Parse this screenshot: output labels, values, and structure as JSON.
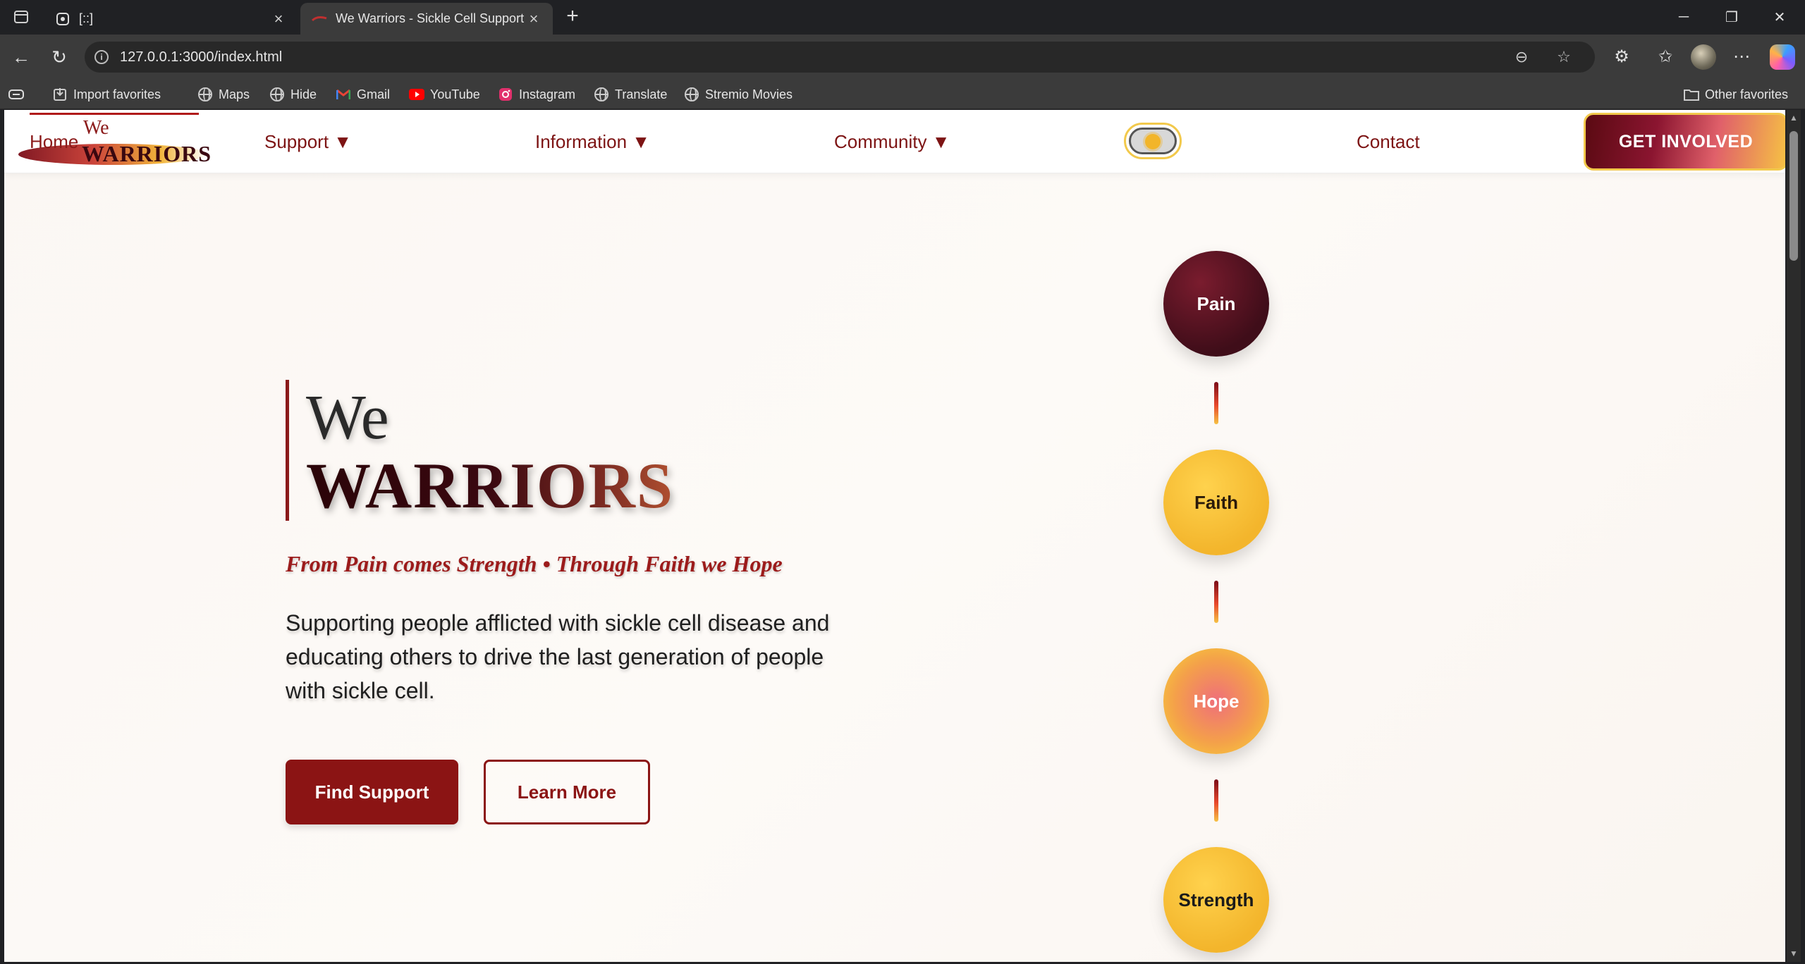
{
  "browser": {
    "tabs": [
      {
        "title": "[::]",
        "active": false
      },
      {
        "title": "We Warriors - Sickle Cell Support",
        "active": true
      }
    ],
    "new_tab": "+",
    "url": "127.0.0.1:3000/index.html",
    "bookmarks": [
      {
        "label": "Import favorites",
        "icon": "import-icon"
      },
      {
        "label": "Maps",
        "icon": "globe-icon"
      },
      {
        "label": "Hide",
        "icon": "globe-icon"
      },
      {
        "label": "Gmail",
        "icon": "gmail-icon"
      },
      {
        "label": "YouTube",
        "icon": "youtube-icon"
      },
      {
        "label": "Instagram",
        "icon": "instagram-icon"
      },
      {
        "label": "Translate",
        "icon": "globe-icon"
      },
      {
        "label": "Stremio Movies",
        "icon": "globe-icon"
      }
    ],
    "other_favorites": "Other favorites"
  },
  "site": {
    "logo": {
      "small": "We",
      "big": "WARRIORS"
    },
    "nav": {
      "home": "Home",
      "support": "Support ▼",
      "information": "Information ▼",
      "community": "Community ▼",
      "contact": "Contact",
      "cta": "GET INVOLVED"
    },
    "hero": {
      "we": "We",
      "warriors": "WARRIORS",
      "tagline": "From Pain comes Strength • Through Faith we Hope",
      "description": "Supporting people afflicted with sickle cell disease and educating others to drive the last generation of people with sickle cell.",
      "primary_button": "Find Support",
      "secondary_button": "Learn More"
    },
    "journey": [
      "Pain",
      "Faith",
      "Hope",
      "Strength"
    ]
  },
  "colors": {
    "brand_red": "#8b1414",
    "brand_gold": "#f3b52c",
    "pain": "#3f0d19"
  }
}
